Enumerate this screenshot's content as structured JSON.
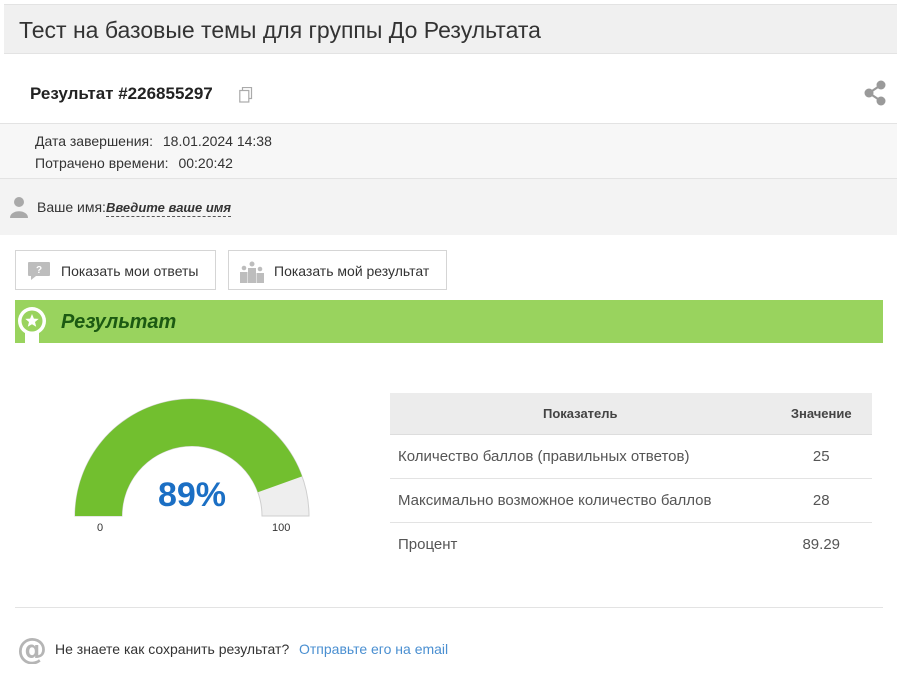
{
  "page": {
    "title": "Тест на базовые темы для группы До Результата"
  },
  "result": {
    "id_label": "Результат #226855297"
  },
  "meta": {
    "completed_label": "Дата завершения:",
    "completed_value": "18.01.2024 14:38",
    "spent_label": "Потрачено времени:",
    "spent_value": "00:20:42"
  },
  "name": {
    "label": "Ваше имя:",
    "placeholder": "Введите ваше имя"
  },
  "buttons": {
    "answers": "Показать мои ответы",
    "result": "Показать мой результат"
  },
  "banner": {
    "title": "Результат"
  },
  "gauge": {
    "percent_text": "89%",
    "percent": 89,
    "min": "0",
    "max": "100"
  },
  "table": {
    "headers": [
      "Показатель",
      "Значение"
    ],
    "rows": [
      {
        "label": "Количество баллов (правильных ответов)",
        "value": "25"
      },
      {
        "label": "Максимально возможное количество баллов",
        "value": "28"
      },
      {
        "label": "Процент",
        "value": "89.29"
      }
    ]
  },
  "footer": {
    "question": "Не знаете как сохранить результат?",
    "link": "Отправьте его на email"
  },
  "colors": {
    "banner": "#99d35e",
    "gauge_fill": "#72bf2f",
    "gauge_empty": "#eeeeee",
    "percent_text": "#1b6fc4",
    "link": "#4a8fd1"
  }
}
